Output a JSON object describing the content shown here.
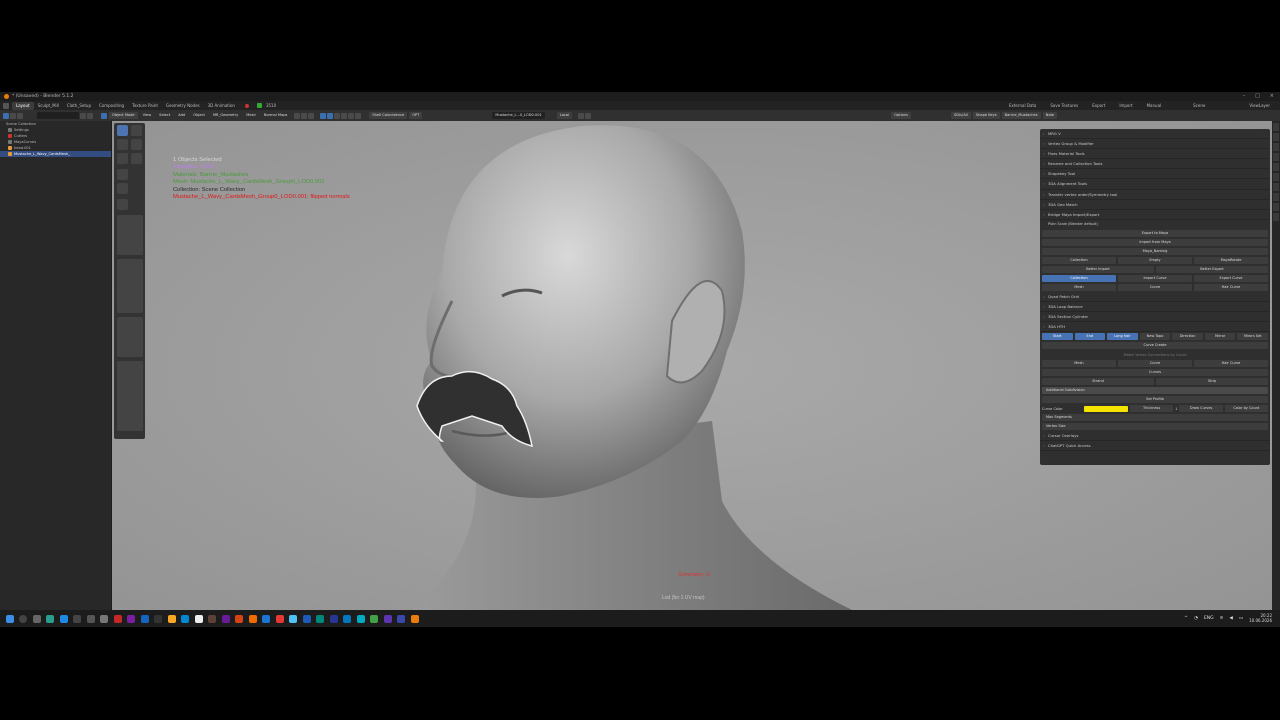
{
  "window": {
    "title": "* (Unsaved) - Blender 5.1.2"
  },
  "menubar": {
    "workspaces": [
      "Layout",
      "Sculpt_Mill",
      "Cloth_Setup",
      "Compositing",
      "Texture Paint",
      "Geometry Nodes",
      "3D Animation"
    ],
    "active": "Layout",
    "counter": "3510",
    "right_items": [
      "External Data",
      "Save Textures",
      "Export",
      "Import",
      "Manual",
      "Scene",
      "ViewLayer"
    ]
  },
  "toolbar": {
    "mode": "Object Mode",
    "menus": [
      "View",
      "Select",
      "Add",
      "Object",
      "MR_Geometry",
      "Mesh",
      "Normal Maps"
    ],
    "shell_label": "Shell Coincidence",
    "opt_label": "OPT",
    "object_field": "Mustache_L...0_LOD0.001",
    "transform": "Local",
    "right_labels": [
      "Options",
      "SDiv/All",
      "Shape Keys",
      "Barrne_Mustaches",
      "Note"
    ]
  },
  "outliner": {
    "search_placeholder": "",
    "items": [
      {
        "label": "Scene Collection",
        "selected": false
      },
      {
        "label": "Settings",
        "selected": false
      },
      {
        "label": "Cutters",
        "selected": false
      },
      {
        "label": "MayaCurves",
        "selected": false
      },
      {
        "label": "head.001",
        "selected": false
      },
      {
        "label": "Mustache_L_Wavy_CardsMesh_",
        "selected": true
      }
    ]
  },
  "viewport": {
    "overlay": [
      {
        "text": "1 Objects Selected",
        "color": "#d8d8d8"
      },
      {
        "text": "Triangles: 3,510",
        "color": "#c07cf0"
      },
      {
        "text": "Materials: Barrne_Mustashes",
        "color": "#4a9a3a"
      },
      {
        "text": "Mesh: Mustache_L_Wavy_CardsMesh_Group0_LOD0.001",
        "color": "#4a9a3a"
      },
      {
        "text": "Collection: Scene Collection",
        "color": "#2b2b2b"
      },
      {
        "text": "Mustache_L_Wavy_CardsMesh_Group0_LOD0.001: flipped normals",
        "color": "#e01818"
      }
    ],
    "symmetry": "Symmetry: X",
    "info": "Lod (for 1 UV map)"
  },
  "npanel": {
    "sections": [
      "MRG V",
      "Vertex Group & Modifier",
      "Fixes Material Tools",
      "Rename and Collection Tools",
      "Shapekey Tool",
      "3DA Alignment Tools",
      "Transfer vertex order/Symmetry tool",
      "3DA Geo Match",
      "Bridge Maya Import/Export"
    ],
    "plain_scale": "Plain Scale (Blender default)",
    "maya_buttons": [
      "Export to Maya",
      "Import from Maya",
      "Maya_Naming"
    ],
    "row_collection": [
      "Collection",
      "Empty",
      "MayaRotate"
    ],
    "row_better": [
      "Better Import",
      "Better Export"
    ],
    "row_curve1": [
      "Collection",
      "Import Curve",
      "Export Curve"
    ],
    "row_curve2": [
      "Mesh",
      "Curve",
      "Hair Curve"
    ],
    "sections2": [
      "Quad Patch Grid",
      "3DA Loop Balance",
      "3DA Section Cylinder",
      "3DA HTH"
    ],
    "hth_row": [
      "Start",
      "End",
      "Long hair",
      "New Topo",
      "Direction",
      "Mirror",
      "Mirors Set"
    ],
    "curve_create": "Curve Create",
    "hint": "Match Vertex Connections by Count",
    "row_curve3": [
      "Mesh",
      "Curve",
      "Hair Curve"
    ],
    "curves_label": "Curves",
    "strand_row": [
      "Strand",
      "Strip"
    ],
    "additional": "Additional Subdivision",
    "set_profile": "Set Profile",
    "curve_color_label": "Curve Color",
    "curve_color": "#f5e400",
    "thickness_label": "Thickness",
    "thickness_val": "1",
    "draw_curves": "Draw Curves",
    "color_by_count": "Color by Count",
    "max_segments": "Max Segments",
    "vertex_size": "Vertex Size",
    "sections3": [
      "Cursor Overlays",
      "ChatGPT Quick Access"
    ]
  },
  "taskbar": {
    "lang": "ENG",
    "time": "20:22",
    "date": "10.06.2026"
  }
}
